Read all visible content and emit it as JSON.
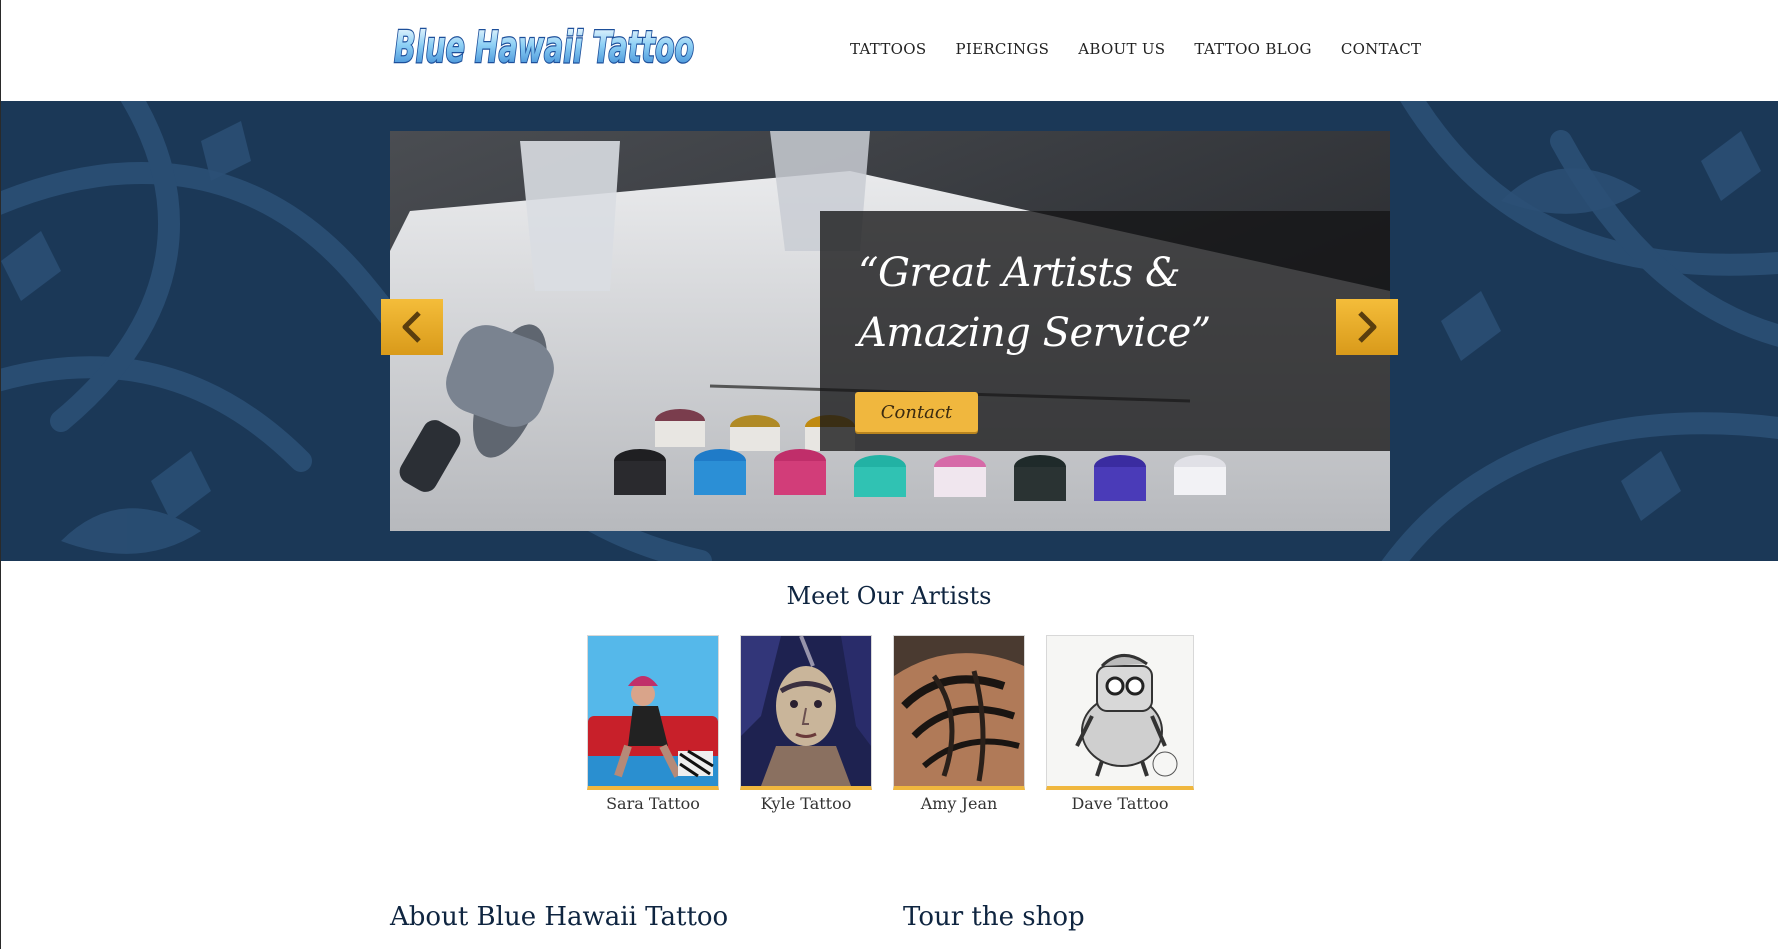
{
  "brand": {
    "logo_text": "Blue Hawaii Tattoo"
  },
  "nav": {
    "items": [
      "TATTOOS",
      "PIERCINGS",
      "ABOUT US",
      "TATTOO BLOG",
      "CONTACT"
    ]
  },
  "hero": {
    "quote": "“Great Artists & Amazing Service”",
    "button_label": "Contact"
  },
  "artists": {
    "title": "Meet Our Artists",
    "items": [
      {
        "name": "Sara Tattoo"
      },
      {
        "name": "Kyle Tattoo"
      },
      {
        "name": "Amy Jean"
      },
      {
        "name": "Dave Tattoo"
      }
    ]
  },
  "sections": {
    "about_title": "About Blue Hawaii Tattoo",
    "tour_title": "Tour the shop"
  },
  "colors": {
    "brand_blue": "#1b3857",
    "accent_gold": "#f0b73e",
    "heading_navy": "#0f2540"
  }
}
